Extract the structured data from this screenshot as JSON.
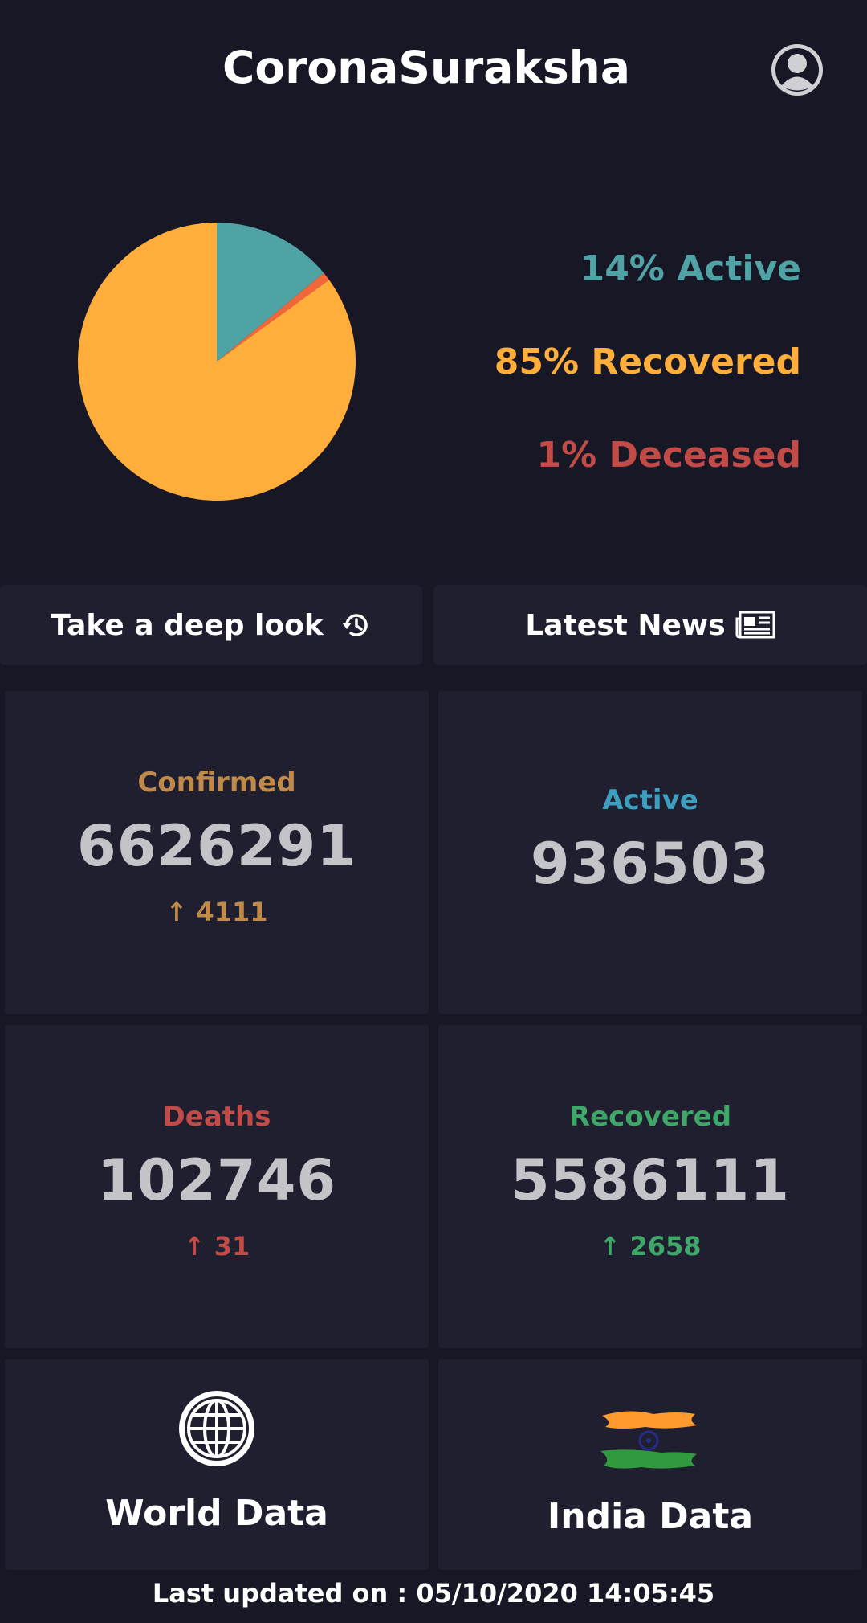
{
  "header": {
    "title": "CoronaSuraksha",
    "profile_icon": "user-circle-icon"
  },
  "colors": {
    "active": "#4fa3a5",
    "recovered": "#ffae3b",
    "deceased": "#c14b47",
    "confirmed": "#c08a4a",
    "active_card": "#3d9fc0",
    "deaths_card": "#c14b47",
    "recovered_card": "#3fa768"
  },
  "chart_data": {
    "type": "pie",
    "slices": [
      {
        "label": "Active",
        "value": 14,
        "color": "#4fa3a5"
      },
      {
        "label": "Deceased",
        "value": 1,
        "color": "#f2673a"
      },
      {
        "label": "Recovered",
        "value": 85,
        "color": "#ffae3b"
      }
    ]
  },
  "legend": {
    "active": "14% Active",
    "recovered": "85% Recovered",
    "deceased": "1% Deceased"
  },
  "buttons": {
    "deep_look": "Take a deep look",
    "deep_look_icon": "history-icon",
    "news": "Latest News",
    "news_icon": "newspaper-icon"
  },
  "stats": {
    "confirmed": {
      "label": "Confirmed",
      "value": "6626291",
      "delta": "↑ 4111"
    },
    "active": {
      "label": "Active",
      "value": "936503"
    },
    "deaths": {
      "label": "Deaths",
      "value": "102746",
      "delta": "↑ 31"
    },
    "recovered": {
      "label": "Recovered",
      "value": "5586111",
      "delta": "↑ 2658"
    }
  },
  "nav": {
    "world": "World Data",
    "world_icon": "globe-icon",
    "india": "India Data",
    "india_icon": "india-flag-icon"
  },
  "footer": {
    "last_updated": "Last updated on : 05/10/2020 14:05:45"
  }
}
